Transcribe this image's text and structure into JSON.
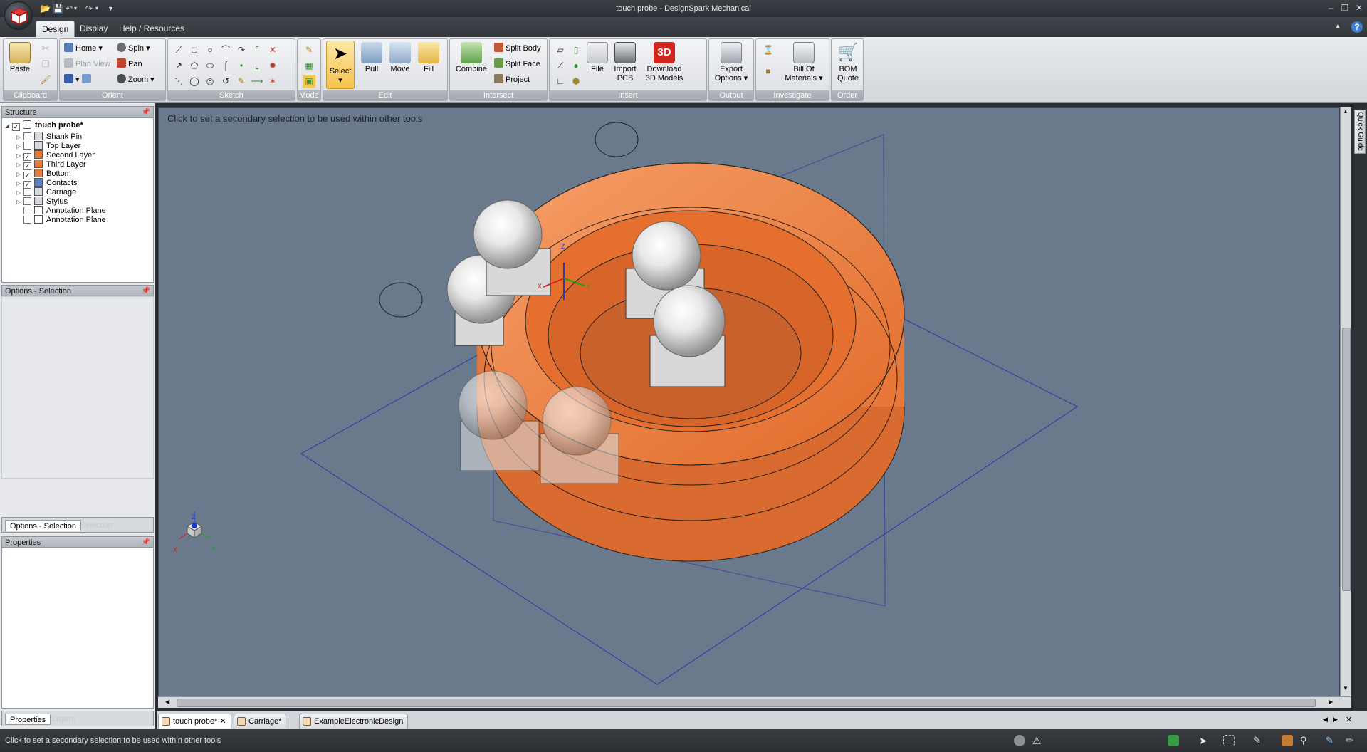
{
  "window": {
    "title": "touch probe - DesignSpark Mechanical"
  },
  "ribbon_tabs": [
    "Design",
    "Display",
    "Help / Resources"
  ],
  "ribbon": {
    "clipboard": {
      "label": "Clipboard",
      "paste": "Paste"
    },
    "orient": {
      "label": "Orient",
      "home": "Home",
      "spin": "Spin",
      "plan_view": "Plan View",
      "pan": "Pan",
      "zoom": "Zoom"
    },
    "sketch": {
      "label": "Sketch"
    },
    "mode": {
      "label": "Mode"
    },
    "edit": {
      "label": "Edit",
      "select": "Select",
      "pull": "Pull",
      "move": "Move",
      "fill": "Fill"
    },
    "intersect": {
      "label": "Intersect",
      "combine": "Combine",
      "split_body": "Split Body",
      "split_face": "Split Face",
      "project": "Project"
    },
    "insert": {
      "label": "Insert",
      "file": "File",
      "import_pcb": "Import PCB",
      "download_3d": "Download 3D Models",
      "badge_3d": "3D"
    },
    "output": {
      "label": "Output",
      "export_options": "Export Options"
    },
    "investigate": {
      "label": "Investigate",
      "bom": "Bill Of Materials"
    },
    "order": {
      "label": "Order",
      "bom_quote": "BOM Quote"
    }
  },
  "structure": {
    "header": "Structure",
    "root": "touch probe*",
    "items": [
      {
        "label": "Shank Pin",
        "checked": false
      },
      {
        "label": "Top Layer",
        "checked": false
      },
      {
        "label": "Second Layer",
        "checked": true
      },
      {
        "label": "Third Layer",
        "checked": true
      },
      {
        "label": "Bottom",
        "checked": true
      },
      {
        "label": "Contacts",
        "checked": true
      },
      {
        "label": "Carriage",
        "checked": false
      },
      {
        "label": "Stylus",
        "checked": false
      },
      {
        "label": "Annotation Plane",
        "checked": false
      },
      {
        "label": "Annotation Plane",
        "checked": false
      }
    ]
  },
  "options": {
    "header": "Options - Selection",
    "tab_active": "Options - Selection",
    "tab_inactive": "Selection"
  },
  "properties": {
    "header": "Properties",
    "tab_active": "Properties",
    "tab_inactive": "Layers"
  },
  "viewport": {
    "hint": "Click to set a secondary selection to be used within other tools",
    "axis_x": "X",
    "axis_y": "Y",
    "axis_z": "Z",
    "colors": {
      "body": "#ee7a35",
      "background": "#6a7a8c"
    }
  },
  "quick_guide": "Quick Guide",
  "doc_tabs": [
    {
      "label": "touch probe*",
      "active": true
    },
    {
      "label": "Carriage*",
      "active": false
    },
    {
      "label": "ExampleElectronicDesign",
      "active": false
    }
  ],
  "status": {
    "message": "Click to set a secondary selection to be used within other tools"
  }
}
